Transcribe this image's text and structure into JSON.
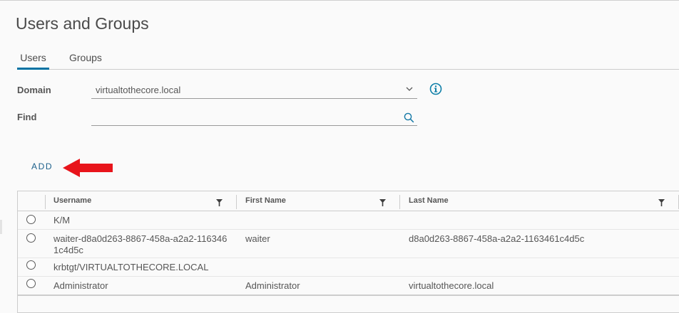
{
  "page": {
    "title": "Users and Groups"
  },
  "tabs": [
    {
      "label": "Users",
      "active": true
    },
    {
      "label": "Groups",
      "active": false
    }
  ],
  "form": {
    "domain_label": "Domain",
    "domain_value": "virtualtothecore.local",
    "find_label": "Find",
    "find_value": "",
    "find_placeholder": ""
  },
  "actions": {
    "add_label": "ADD"
  },
  "table": {
    "columns": [
      "Username",
      "First Name",
      "Last Name"
    ],
    "rows": [
      {
        "username": "K/M",
        "first_name": "",
        "last_name": ""
      },
      {
        "username": "waiter-d8a0d263-8867-458a-a2a2-1163461c4d5c",
        "first_name": "waiter",
        "last_name": "d8a0d263-8867-458a-a2a2-1163461c4d5c"
      },
      {
        "username": "krbtgt/VIRTUALTOTHECORE.LOCAL",
        "first_name": "",
        "last_name": ""
      },
      {
        "username": "Administrator",
        "first_name": "Administrator",
        "last_name": "virtualtothecore.local"
      }
    ]
  },
  "icons": {
    "chevron": "chevron-down-icon",
    "info": "info-icon",
    "search": "search-icon",
    "filter": "filter-icon",
    "arrow": "red-arrow-annotation"
  },
  "colors": {
    "accent": "#0072a3",
    "add_button": "#1b5f8a",
    "annotation_arrow": "#e8141b"
  }
}
